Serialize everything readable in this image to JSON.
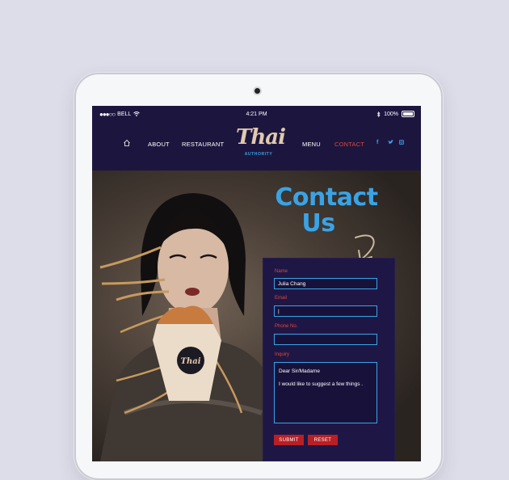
{
  "statusbar": {
    "carrier": "BELL",
    "time": "4:21 PM",
    "battery": "100%"
  },
  "nav": {
    "about": "ABOUT",
    "restaurant": "RESTAURANT",
    "menu": "MENU",
    "contact": "CONTACT"
  },
  "logo": {
    "word": "Thai",
    "sub": "AUTHORITY"
  },
  "social": {
    "facebook": "f",
    "twitter": "t",
    "instagram": "ig"
  },
  "hero": {
    "title_line1": "Contact",
    "title_line2": "Us"
  },
  "form": {
    "name_label": "Name",
    "name_value": "Julia Chang",
    "email_label": "Email",
    "email_value": "|",
    "phone_label": "Phone No.",
    "phone_value": "",
    "inquiry_label": "Inquiry",
    "inquiry_line1": "Dear Sir/Madame",
    "inquiry_line2": "I would like to suggest a few things .",
    "submit_label": "SUBMIT",
    "reset_label": "RESET"
  },
  "colors": {
    "background": "#dcdde8",
    "screen": "#1c163f",
    "accent_blue": "#3aa3e5",
    "accent_red": "#e0463d",
    "button_red": "#b72025"
  },
  "icons": [
    "home-icon",
    "wifi-icon",
    "bluetooth-icon",
    "battery-icon",
    "facebook-icon",
    "twitter-icon",
    "instagram-icon"
  ]
}
